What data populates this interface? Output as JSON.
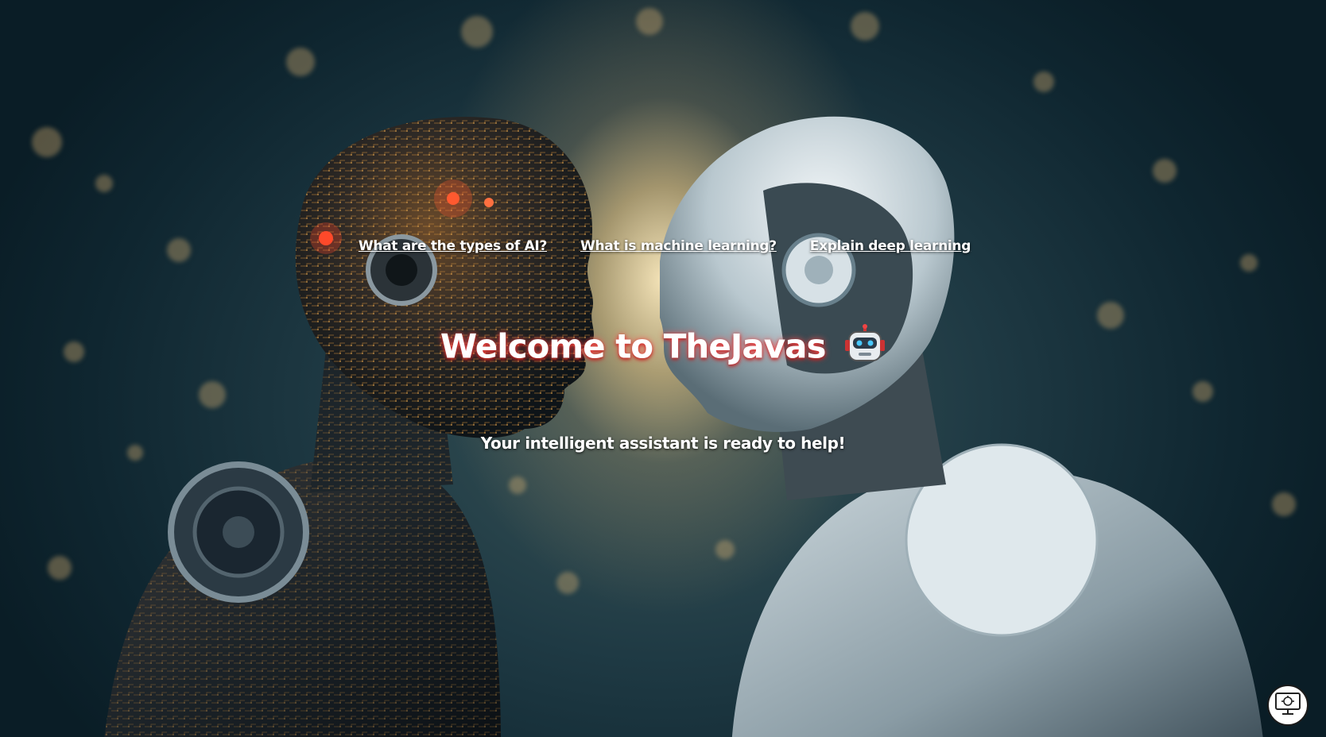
{
  "suggestions": [
    {
      "label": "What are the types of AI?"
    },
    {
      "label": "What is machine learning?"
    },
    {
      "label": "Explain deep learning"
    }
  ],
  "welcome": {
    "title": "Welcome to TheJavas",
    "title_icon": "robot-face-icon",
    "subtitle": "Your intelligent assistant is ready to help!"
  },
  "chat_launcher": {
    "icon": "computer-robot-icon"
  },
  "colors": {
    "background_dark": "#0f2630",
    "glow": "#ffecbe",
    "title_shadow": "#ff5050"
  }
}
